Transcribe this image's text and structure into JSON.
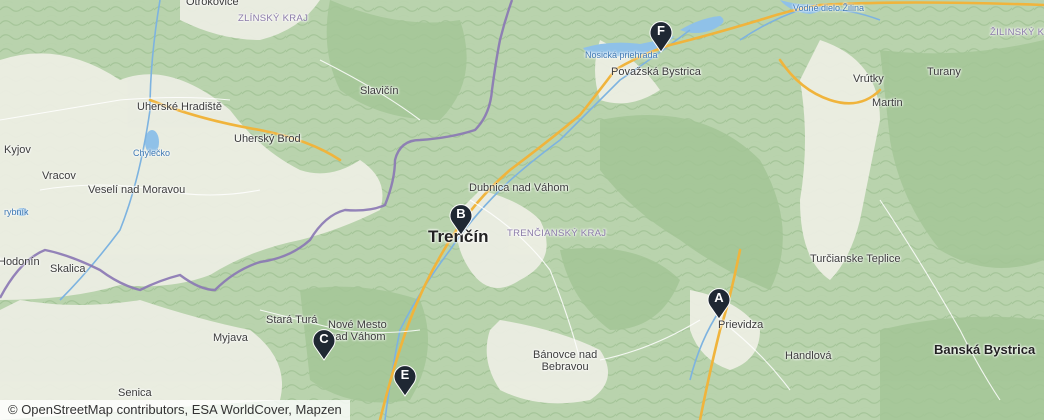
{
  "labels": {
    "otrokovice": "Otrokovice",
    "zlinsky_kraj": "ZLÍNSKÝ KRAJ",
    "uherske_hradiste": "Uherské Hradiště",
    "chylecko": "Chylečko",
    "uhersky_brod": "Uherský Brod",
    "slavicin": "Slavičín",
    "kyjov": "Kyjov",
    "vracov": "Vracov",
    "veseli": "Veselí nad Moravou",
    "rybnik": "rybník",
    "hodonin": "Hodonín",
    "skalica": "Skalica",
    "senica": "Senica",
    "myjava": "Myjava",
    "stara_tura": "Stará Turá",
    "nove_mesto": "Nové Mesto\nnad Váhom",
    "dubnica": "Dubnica nad Váhom",
    "trencin": "Trenčín",
    "trenciansky_kraj": "TRENČIANSKÝ KRAJ",
    "nosicka": "Nosická priehrada",
    "povazska": "Považská Bystrica",
    "vodne_dielo": "Vodné dielo Žilina",
    "zilinsky_kraj_sk": "ŽILINSKÝ KRAJ",
    "vrutky": "Vrútky",
    "turany": "Turany",
    "martin": "Martin",
    "turcianske": "Turčianske Teplice",
    "prievidza": "Prievidza",
    "handlova": "Handlová",
    "banovce": "Bánovce nad\nBebravou",
    "banska_bystrica": "Banská Bystrica"
  },
  "markers": [
    {
      "id": "A",
      "label": "A"
    },
    {
      "id": "B",
      "label": "B"
    },
    {
      "id": "C",
      "label": "C"
    },
    {
      "id": "E",
      "label": "E"
    },
    {
      "id": "F",
      "label": "F"
    }
  ],
  "colors": {
    "marker": "#1f2833",
    "border": "#8a77b4",
    "highway": "#f0b43c",
    "water": "#8fc1e8",
    "lowland": "#eef0e6",
    "forest": "#a9c99c"
  },
  "attribution": "© OpenStreetMap contributors, ESA WorldCover, Mapzen"
}
